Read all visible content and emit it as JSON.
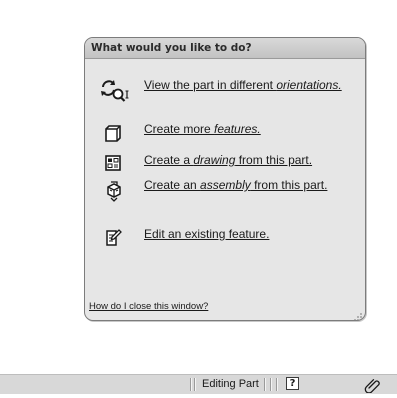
{
  "task_panel": {
    "title": "What would you like to do?",
    "items": [
      {
        "icon": "view-orientation-icon",
        "parts": [
          "View the part in different ",
          "orientations."
        ],
        "italic": [
          false,
          true
        ]
      },
      {
        "icon": "feature-box-icon",
        "parts": [
          "Create more ",
          "features."
        ],
        "italic": [
          false,
          true
        ]
      },
      {
        "icon": "drawing-sheet-icon",
        "parts": [
          "Create a ",
          "drawing",
          " from this part."
        ],
        "italic": [
          false,
          true,
          false
        ]
      },
      {
        "icon": "assembly-icon",
        "parts": [
          "Create an ",
          "assembly",
          " from this part."
        ],
        "italic": [
          false,
          true,
          false
        ]
      },
      {
        "icon": "edit-feature-icon",
        "parts": [
          "Edit an existing feature."
        ],
        "italic": [
          false
        ]
      }
    ],
    "close_help": "How do I close this window?"
  },
  "status_bar": {
    "mode_text": "Editing Part",
    "help_glyph": "?",
    "attach_icon": "paperclip-icon"
  },
  "colors": {
    "panel_background": "#e6e6e6",
    "panel_header": "#c9c9c9",
    "panel_border": "#7c7c7c",
    "status_bar": "#d8d8d8"
  }
}
